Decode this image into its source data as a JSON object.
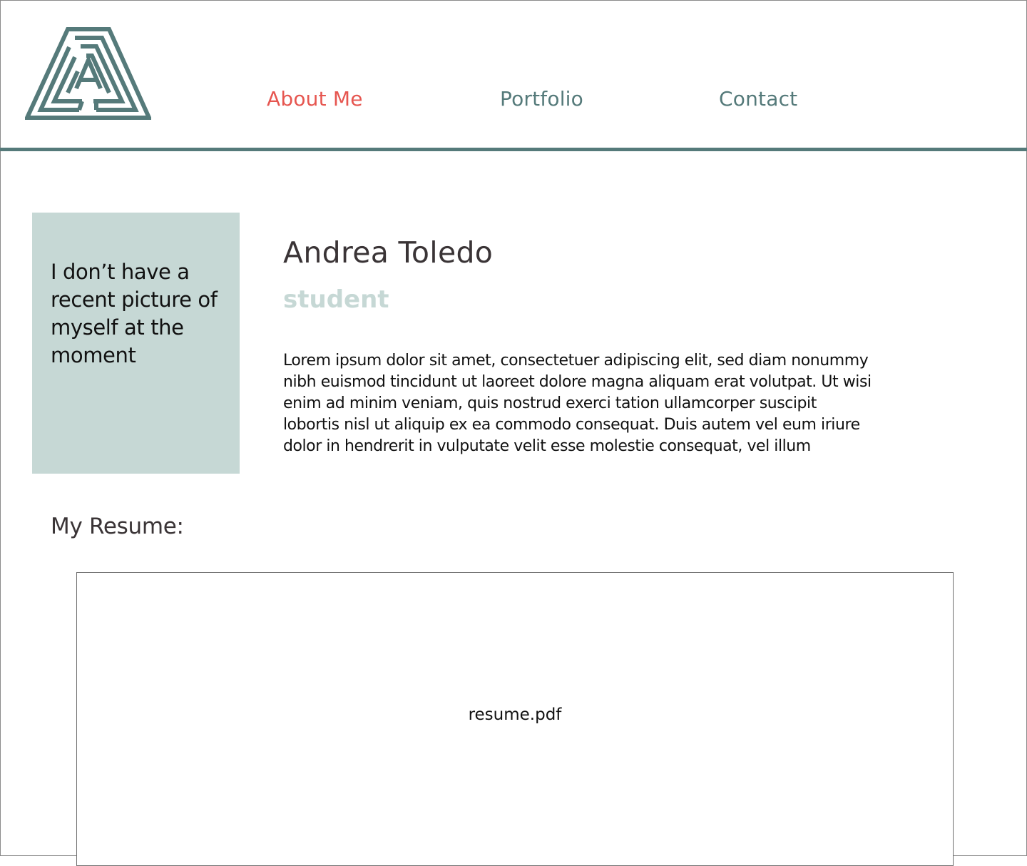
{
  "brand": {
    "logo_icon": "maze-triangle-a-logo",
    "logo_color": "#557a7a"
  },
  "nav": {
    "items": [
      {
        "label": "About Me",
        "active": true
      },
      {
        "label": "Portfolio",
        "active": false
      },
      {
        "label": "Contact",
        "active": false
      }
    ]
  },
  "photo": {
    "placeholder_text": "I don’t have a recent picture of myself at the moment"
  },
  "profile": {
    "name": "Andrea Toledo",
    "role": "student",
    "bio": "Lorem ipsum dolor sit amet, consectetuer adipiscing elit, sed diam nonummy nibh euismod tincidunt ut laoreet dolore magna aliquam erat volutpat. Ut wisi enim ad minim veniam, quis nostrud exerci tation ullamcorper suscipit lobortis nisl ut aliquip ex ea commodo consequat. Duis autem vel eum iriure dolor in hendrerit in vulputate velit esse molestie consequat, vel illum"
  },
  "resume": {
    "heading": "My Resume:",
    "filename": "resume.pdf"
  },
  "colors": {
    "accent": "#e65650",
    "brand": "#557a7a",
    "placeholder_bg": "#c6d8d5",
    "text_dark": "#3a3436"
  }
}
